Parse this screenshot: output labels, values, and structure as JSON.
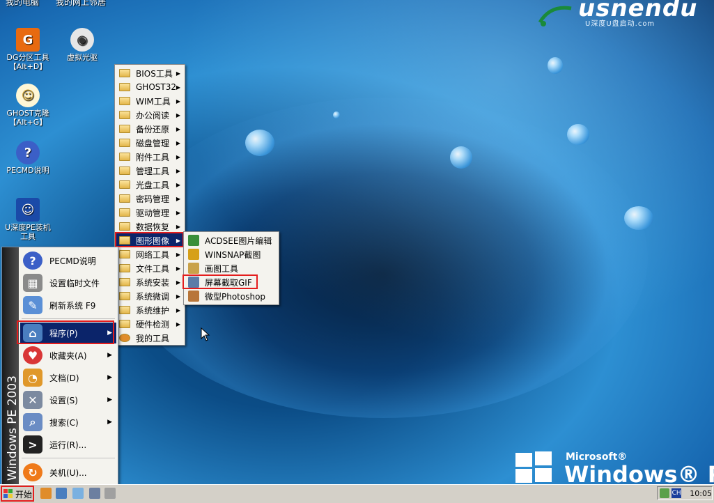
{
  "top_cut": [
    "我的电脑",
    "我的网上邻居"
  ],
  "brand": {
    "text": "usnendu",
    "sub": "U深度U盘启动.com"
  },
  "desktop_icons": [
    {
      "l1": "DG分区工具",
      "l2": "【Alt+D】",
      "icon": "disk-partition-icon"
    },
    {
      "l1": "虚拟光驱",
      "l2": "",
      "icon": "virtual-drive-icon"
    },
    {
      "l1": "GHOST克隆",
      "l2": "【Alt+G】",
      "icon": "ghost-icon"
    },
    {
      "l1": "PECMD说明",
      "l2": "",
      "icon": "help-icon"
    },
    {
      "l1": "U深度PE装机",
      "l2": "工具",
      "icon": "pe-installer-icon"
    }
  ],
  "start_menu": {
    "band": "Windows PE 2003",
    "items": [
      {
        "label": "PECMD说明",
        "icon": "help-icon"
      },
      {
        "label": "设置临时文件",
        "icon": "memory-icon"
      },
      {
        "label": "刷新系统 F9",
        "icon": "refresh-icon"
      },
      {
        "label": "程序(P)",
        "icon": "programs-icon"
      },
      {
        "label": "收藏夹(A)",
        "icon": "favorites-icon"
      },
      {
        "label": "文档(D)",
        "icon": "documents-icon"
      },
      {
        "label": "设置(S)",
        "icon": "settings-icon"
      },
      {
        "label": "搜索(C)",
        "icon": "search-icon"
      },
      {
        "label": "运行(R)...",
        "icon": "run-icon"
      },
      {
        "label": "关机(U)...",
        "icon": "shutdown-icon"
      }
    ]
  },
  "programs_menu": [
    "BIOS工具",
    "GHOST32",
    "WIM工具",
    "办公阅读",
    "备份还原",
    "磁盘管理",
    "附件工具",
    "管理工具",
    "光盘工具",
    "密码管理",
    "驱动管理",
    "数据恢复",
    "图形图像",
    "网络工具",
    "文件工具",
    "系统安装",
    "系统微调",
    "系统维护",
    "硬件检测",
    "我的工具"
  ],
  "graphics_menu": [
    {
      "label": "ACDSEE图片编辑",
      "color": "#3a8f3a"
    },
    {
      "label": "WINSNAP截图",
      "color": "#d6a019"
    },
    {
      "label": "画图工具",
      "color": "#c9a24a"
    },
    {
      "label": "屏幕截取GIF",
      "color": "#5b7ca8"
    },
    {
      "label": "微型Photoshop",
      "color": "#b8763a"
    }
  ],
  "taskbar": {
    "start": "开始",
    "tray_lang": "CH",
    "clock": "10:05"
  },
  "winpe": {
    "ms": "Microsoft®",
    "name": "Windows® PE"
  }
}
